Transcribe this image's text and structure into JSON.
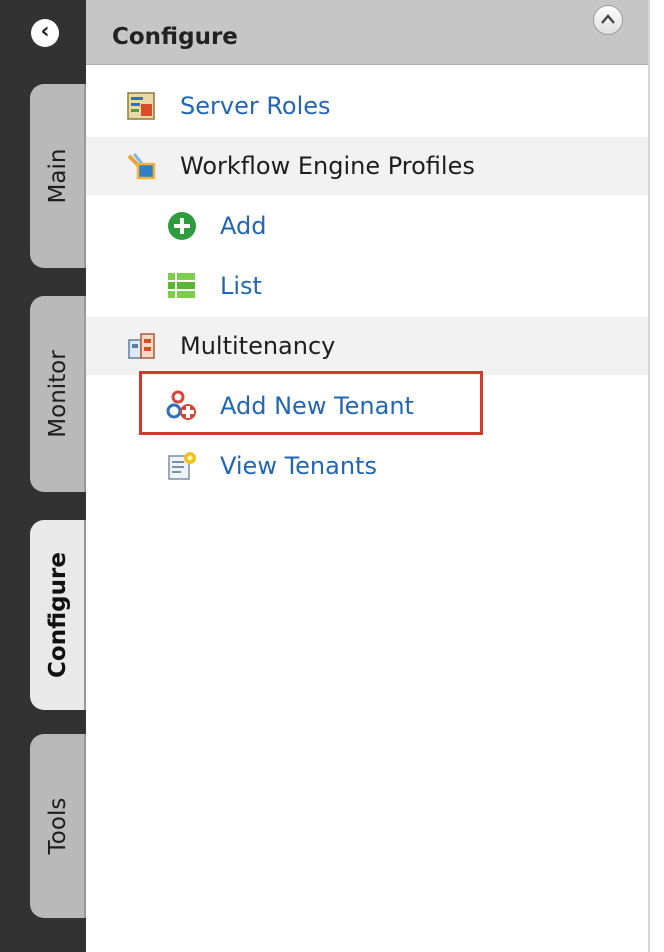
{
  "rail": {
    "tabs": [
      {
        "label": "Main"
      },
      {
        "label": "Monitor"
      },
      {
        "label": "Configure",
        "active": true
      },
      {
        "label": "Tools"
      }
    ]
  },
  "panel": {
    "title": "Configure",
    "items": [
      {
        "label": "Server Roles",
        "icon": "server-roles-icon"
      },
      {
        "label": "Workflow Engine Profiles",
        "icon": "workflow-engine-icon"
      },
      {
        "label": "Add",
        "icon": "add-icon"
      },
      {
        "label": "List",
        "icon": "list-icon"
      },
      {
        "label": "Multitenancy",
        "icon": "multitenancy-icon"
      },
      {
        "label": "Add New Tenant",
        "icon": "add-tenant-icon",
        "highlighted": true
      },
      {
        "label": "View Tenants",
        "icon": "view-tenants-icon"
      }
    ]
  },
  "colors": {
    "link": "#2367b3",
    "highlight": "#cf3b2b",
    "rail": "#323232",
    "header": "#c6c6c6"
  }
}
